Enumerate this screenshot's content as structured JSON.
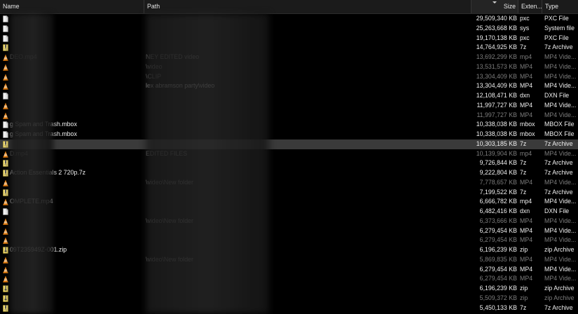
{
  "columns": {
    "name": "Name",
    "path": "Path",
    "size": "Size",
    "ext": "Exten...",
    "type": "Type"
  },
  "rows": [
    {
      "icon": "file-icon",
      "name": "",
      "path": "",
      "size": "29,509,340 KB",
      "ext": "pxc",
      "type": "PXC File",
      "dim": false,
      "selected": false
    },
    {
      "icon": "file-icon",
      "name": "",
      "path": "",
      "size": "25,263,668 KB",
      "ext": "sys",
      "type": "System file",
      "dim": false,
      "selected": false
    },
    {
      "icon": "file-icon",
      "name": "",
      "path": "",
      "size": "19,170,138 KB",
      "ext": "pxc",
      "type": "PXC File",
      "dim": false,
      "selected": false
    },
    {
      "icon": "archive-icon",
      "name": "",
      "path": "",
      "size": "14,764,925 KB",
      "ext": "7z",
      "type": "7z Archive",
      "dim": false,
      "selected": false
    },
    {
      "icon": "vlc-icon",
      "name": "DEO.mp4",
      "path": "NEY EDITED video",
      "size": "13,692,299 KB",
      "ext": "mp4",
      "type": "MP4 Vide...",
      "dim": true,
      "selected": false
    },
    {
      "icon": "vlc-icon",
      "name": "",
      "path": "\\video",
      "size": "13,531,573 KB",
      "ext": "MP4",
      "type": "MP4 Vide...",
      "dim": true,
      "selected": false
    },
    {
      "icon": "vlc-icon",
      "name": "",
      "path": "\\CLIP",
      "size": "13,304,409 KB",
      "ext": "MP4",
      "type": "MP4 Vide...",
      "dim": true,
      "selected": false
    },
    {
      "icon": "vlc-icon",
      "name": "",
      "path": "lex abramson party\\video",
      "size": "13,304,409 KB",
      "ext": "MP4",
      "type": "MP4 Vide...",
      "dim": false,
      "selected": false
    },
    {
      "icon": "file-icon",
      "name": "",
      "path": "",
      "size": "12,108,471 KB",
      "ext": "dxn",
      "type": "DXN File",
      "dim": false,
      "selected": false
    },
    {
      "icon": "vlc-icon",
      "name": "",
      "path": "",
      "size": "11,997,727 KB",
      "ext": "MP4",
      "type": "MP4 Vide...",
      "dim": false,
      "selected": false
    },
    {
      "icon": "vlc-icon",
      "name": "",
      "path": "",
      "size": "11,997,727 KB",
      "ext": "MP4",
      "type": "MP4 Vide...",
      "dim": true,
      "selected": false
    },
    {
      "icon": "file-icon",
      "name": "g Spam and Trash.mbox",
      "path": "",
      "size": "10,338,038 KB",
      "ext": "mbox",
      "type": "MBOX File",
      "dim": false,
      "selected": false
    },
    {
      "icon": "file-icon",
      "name": "g Spam and Trash.mbox",
      "path": "",
      "size": "10,338,038 KB",
      "ext": "mbox",
      "type": "MBOX File",
      "dim": false,
      "selected": false
    },
    {
      "icon": "archive-icon",
      "name": "",
      "path": "",
      "size": "10,303,185 KB",
      "ext": "7z",
      "type": "7z Archive",
      "dim": false,
      "selected": true
    },
    {
      "icon": "vlc-icon",
      "name": "D.mp4",
      "path": "EDITED FILES",
      "size": "10,139,904 KB",
      "ext": "mp4",
      "type": "MP4 Vide...",
      "dim": true,
      "selected": false
    },
    {
      "icon": "archive-icon",
      "name": "",
      "path": "",
      "size": "9,726,844 KB",
      "ext": "7z",
      "type": "7z Archive",
      "dim": false,
      "selected": false
    },
    {
      "icon": "archive-icon",
      "name": "Action Essentials 2 720p.7z",
      "path": "",
      "size": "9,222,804 KB",
      "ext": "7z",
      "type": "7z Archive",
      "dim": false,
      "selected": false
    },
    {
      "icon": "vlc-icon",
      "name": "",
      "path": "\\video\\New folder",
      "size": "7,778,657 KB",
      "ext": "MP4",
      "type": "MP4 Vide...",
      "dim": true,
      "selected": false
    },
    {
      "icon": "archive-icon",
      "name": "",
      "path": "",
      "size": "7,199,522 KB",
      "ext": "7z",
      "type": "7z Archive",
      "dim": false,
      "selected": false
    },
    {
      "icon": "vlc-icon",
      "name": "OMPLETE.mp4",
      "path": "",
      "size": "6,666,782 KB",
      "ext": "mp4",
      "type": "MP4 Vide...",
      "dim": false,
      "selected": false
    },
    {
      "icon": "file-icon",
      "name": "",
      "path": "",
      "size": "6,482,416 KB",
      "ext": "dxn",
      "type": "DXN File",
      "dim": false,
      "selected": false
    },
    {
      "icon": "vlc-icon",
      "name": "",
      "path": "\\video\\New folder",
      "size": "6,373,666 KB",
      "ext": "MP4",
      "type": "MP4 Vide...",
      "dim": true,
      "selected": false
    },
    {
      "icon": "vlc-icon",
      "name": "",
      "path": "",
      "size": "6,279,454 KB",
      "ext": "MP4",
      "type": "MP4 Vide...",
      "dim": false,
      "selected": false
    },
    {
      "icon": "vlc-icon",
      "name": "",
      "path": "",
      "size": "6,279,454 KB",
      "ext": "MP4",
      "type": "MP4 Vide...",
      "dim": true,
      "selected": false
    },
    {
      "icon": "zip-icon",
      "name": "09T235949Z-001.zip",
      "path": "",
      "size": "6,196,239 KB",
      "ext": "zip",
      "type": "zip Archive",
      "dim": false,
      "selected": false
    },
    {
      "icon": "vlc-icon",
      "name": "",
      "path": "\\video\\New folder",
      "size": "5,869,835 KB",
      "ext": "MP4",
      "type": "MP4 Vide...",
      "dim": true,
      "selected": false
    },
    {
      "icon": "vlc-icon",
      "name": "",
      "path": "",
      "size": "6,279,454 KB",
      "ext": "MP4",
      "type": "MP4 Vide...",
      "dim": false,
      "selected": false
    },
    {
      "icon": "vlc-icon",
      "name": "",
      "path": "",
      "size": "6,279,454 KB",
      "ext": "MP4",
      "type": "MP4 Vide...",
      "dim": true,
      "selected": false
    },
    {
      "icon": "zip-icon",
      "name": "",
      "path": "",
      "size": "6,196,239 KB",
      "ext": "zip",
      "type": "zip Archive",
      "dim": false,
      "selected": false
    },
    {
      "icon": "zip-icon",
      "name": "",
      "path": "",
      "size": "5,509,372 KB",
      "ext": "zip",
      "type": "zip Archive",
      "dim": true,
      "selected": false
    },
    {
      "icon": "archive-icon",
      "name": "",
      "path": "",
      "size": "5,450,133 KB",
      "ext": "7z",
      "type": "7z Archive",
      "dim": false,
      "selected": false
    }
  ]
}
